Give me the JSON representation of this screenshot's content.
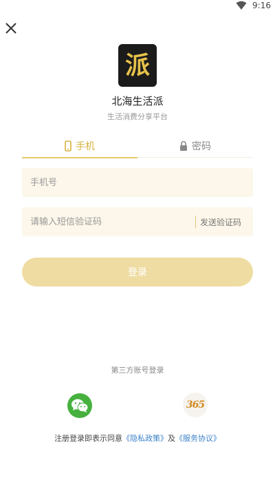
{
  "status_bar": {
    "time": "9:16"
  },
  "app": {
    "logo_char": "派",
    "name": "北海生活派",
    "subtitle": "生活消费分享平台"
  },
  "tabs": [
    {
      "label": "手机",
      "active": true
    },
    {
      "label": "密码",
      "active": false
    }
  ],
  "form": {
    "phone_placeholder": "手机号",
    "code_placeholder": "请输入短信验证码",
    "send_code_label": "发送验证码",
    "login_label": "登录"
  },
  "third_party": {
    "title": "第三方账号登录",
    "brand_text": "365"
  },
  "agreement": {
    "prefix": "注册登录即表示同意",
    "privacy": "《隐私政策》",
    "conjunction": "及",
    "service": "《服务协议》"
  },
  "colors": {
    "accent": "#d7b240",
    "login_button": "#efdca3",
    "input_bg": "#fcf7ea",
    "wechat": "#46b13e",
    "link": "#3c82c8"
  }
}
